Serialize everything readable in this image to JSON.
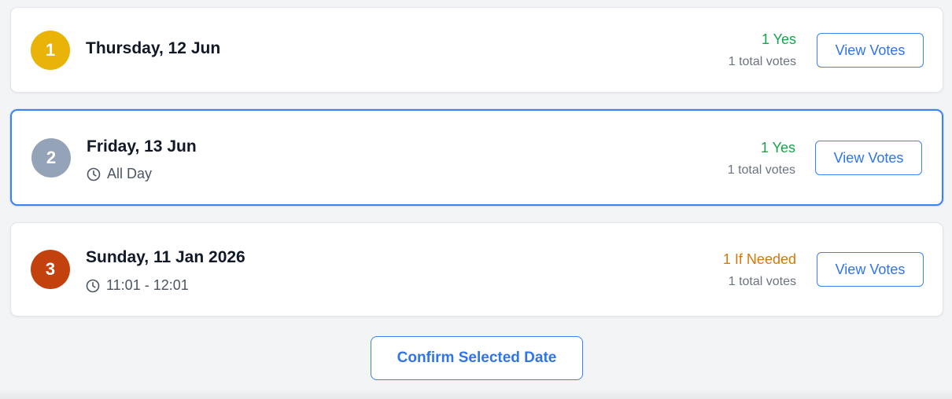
{
  "colors": {
    "accent": "#3b82f6",
    "yes": "#16a34a",
    "if_needed": "#d97706",
    "rank_1": "#eab308",
    "rank_2": "#94a3b8",
    "rank_3": "#c2410c"
  },
  "dates": [
    {
      "rank": "1",
      "title": "Thursday, 12 Jun",
      "time": "",
      "summary": "1 Yes",
      "total": "1 total votes",
      "view_label": "View Votes",
      "selected": false
    },
    {
      "rank": "2",
      "title": "Friday, 13 Jun",
      "time": "All Day",
      "time_icon": "clock-icon",
      "summary": "1 Yes",
      "total": "1 total votes",
      "view_label": "View Votes",
      "selected": true
    },
    {
      "rank": "3",
      "title": "Sunday, 11 Jan 2026",
      "time": "11:01 - 12:01",
      "time_icon": "clock-icon",
      "summary": "1 If Needed",
      "total": "1 total votes",
      "view_label": "View Votes",
      "selected": false
    }
  ],
  "confirm_label": "Confirm Selected Date"
}
